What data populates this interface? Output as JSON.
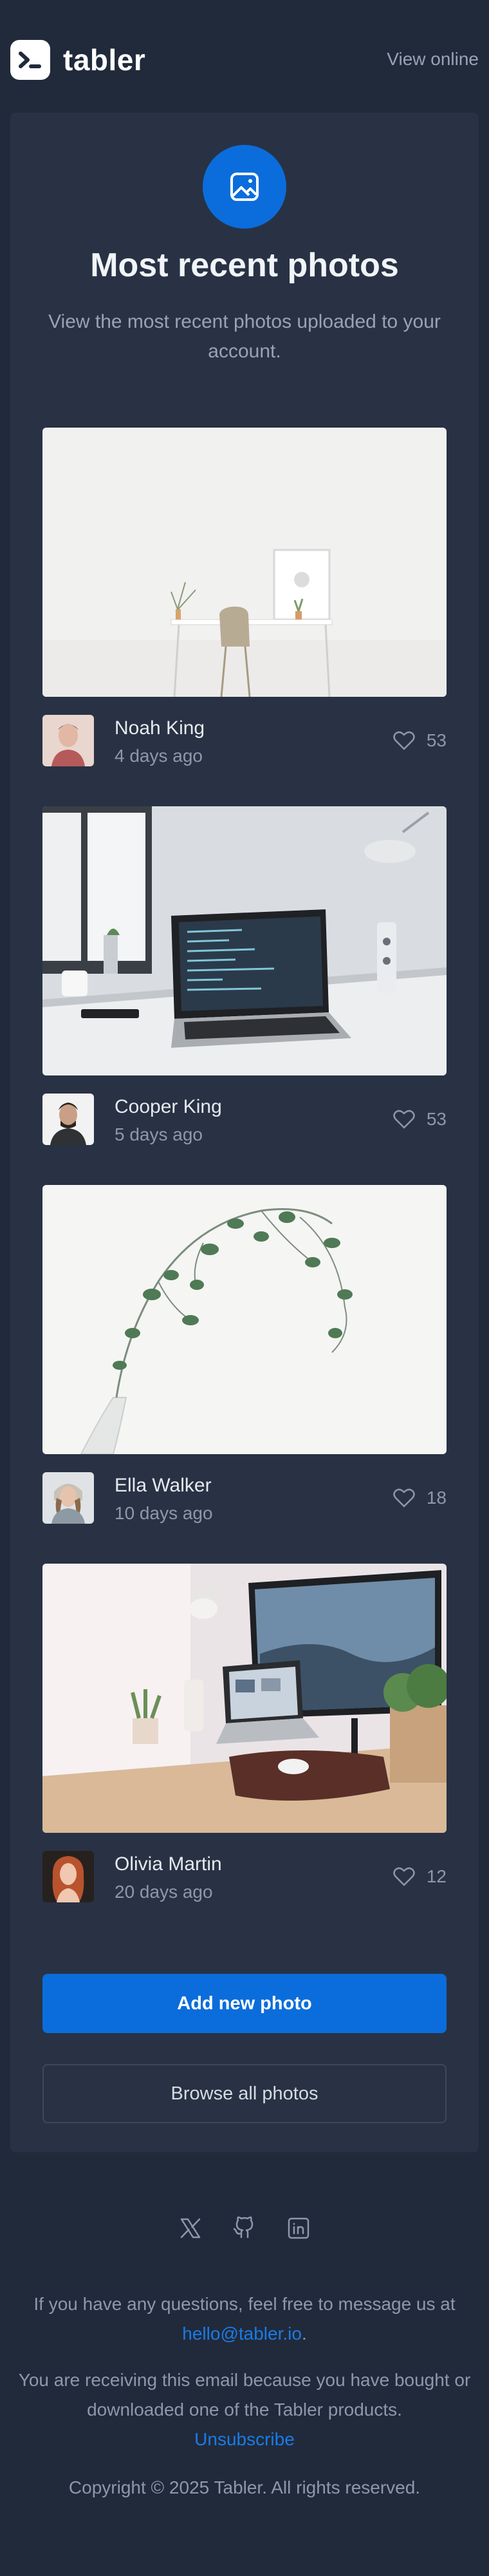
{
  "header": {
    "brand": "tabler",
    "view_online": "View online"
  },
  "hero": {
    "icon": "image-icon",
    "title": "Most recent photos",
    "subtitle": "View the most recent photos uploaded to your account."
  },
  "photos": [
    {
      "author": "Noah King",
      "time": "4 days ago",
      "likes": "53",
      "image": "white desk with chair and plants"
    },
    {
      "author": "Cooper King",
      "time": "5 days ago",
      "likes": "53",
      "image": "laptop on desk showing code"
    },
    {
      "author": "Ella Walker",
      "time": "10 days ago",
      "likes": "18",
      "image": "eucalyptus branch in glass vase"
    },
    {
      "author": "Olivia Martin",
      "time": "20 days ago",
      "likes": "12",
      "image": "desk with monitor and laptop"
    }
  ],
  "actions": {
    "primary": "Add new photo",
    "secondary": "Browse all photos"
  },
  "social": [
    "x-icon",
    "github-icon",
    "linkedin-icon"
  ],
  "footer": {
    "contact_prefix": "If you have any questions, feel free to message us at",
    "contact_email": "hello@tabler.io",
    "contact_suffix": ".",
    "notice": "You are receiving this email because you have bought or downloaded one of the Tabler products.",
    "unsubscribe": "Unsubscribe",
    "copyright": "Copyright © 2025 Tabler. All rights reserved."
  },
  "colors": {
    "background": "#212a3b",
    "card": "#283244",
    "accent": "#0b6ddb",
    "link": "#1a7be6"
  }
}
